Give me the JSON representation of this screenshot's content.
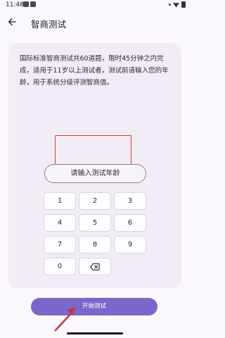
{
  "status": {
    "time": "11:48"
  },
  "header": {
    "title": "智商测试"
  },
  "intro": {
    "text": "国际标准智商测试共60道题，限时45分钟之内完成，适用于11岁以上测试者，测试前请输入您的年龄，用于系统分级评测智商值。"
  },
  "age_field": {
    "placeholder": "请输入测试年龄"
  },
  "keypad": {
    "keys": [
      "1",
      "2",
      "3",
      "4",
      "5",
      "6",
      "7",
      "8",
      "9",
      "0"
    ]
  },
  "start_button": {
    "label": "开始测试"
  },
  "annotation_colors": {
    "highlight_box": "#e13b3b",
    "pointer_arrow": "#c93535"
  },
  "accent": {
    "primary": "#7a67c9"
  }
}
